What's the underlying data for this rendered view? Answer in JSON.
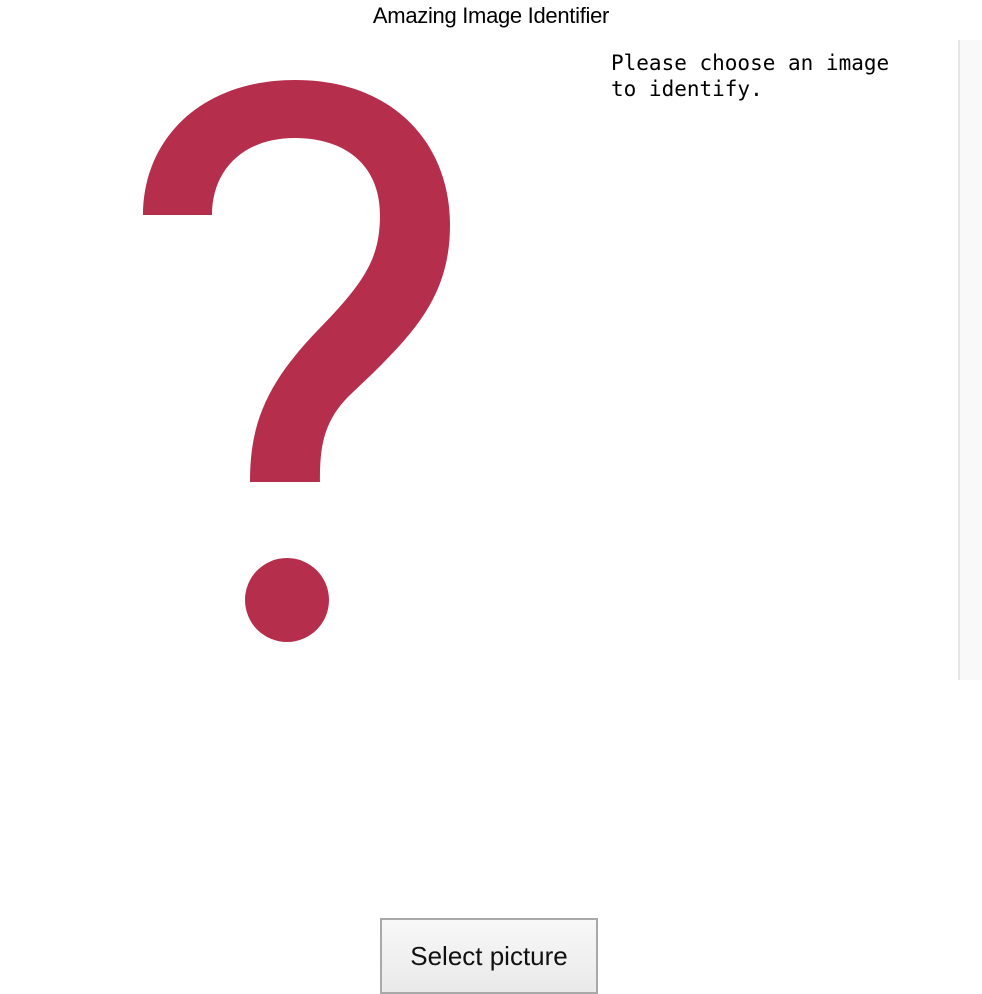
{
  "window": {
    "title": "Amazing Image Identifier"
  },
  "image_panel": {
    "placeholder_icon": "question-mark-icon",
    "icon_color": "#B52E4B"
  },
  "result": {
    "text": "Please choose an image\nto identify."
  },
  "actions": {
    "select_label": "Select picture"
  }
}
